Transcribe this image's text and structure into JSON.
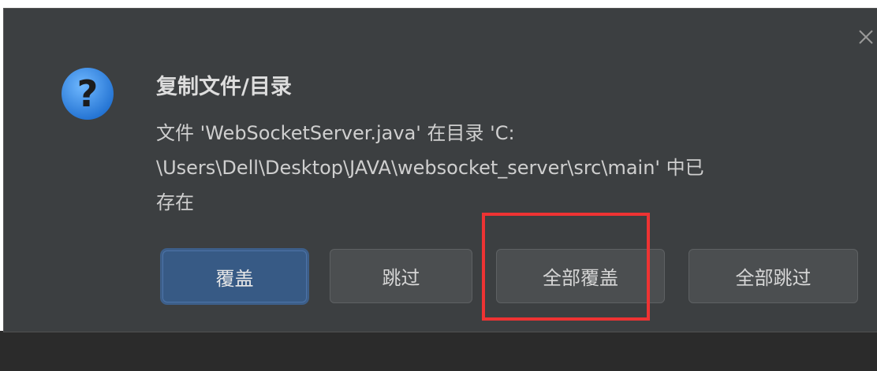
{
  "dialog": {
    "title": "复制文件/目录",
    "message_lines": [
      "文件 'WebSocketServer.java' 在目录 'C:",
      "\\Users\\Dell\\Desktop\\JAVA\\websocket_server\\src\\main' 中已",
      "存在"
    ],
    "icons": {
      "question": "question-icon",
      "close": "close-icon"
    }
  },
  "buttons": {
    "overwrite": "覆盖",
    "skip": "跳过",
    "overwrite_all": "全部覆盖",
    "skip_all": "全部跳过"
  },
  "colors": {
    "dialog_bg": "#3c3f41",
    "primary_button": "#375a85",
    "button_bg": "#4b4e50",
    "highlight": "#ee3333",
    "icon_blue": "#3d8ee8"
  }
}
